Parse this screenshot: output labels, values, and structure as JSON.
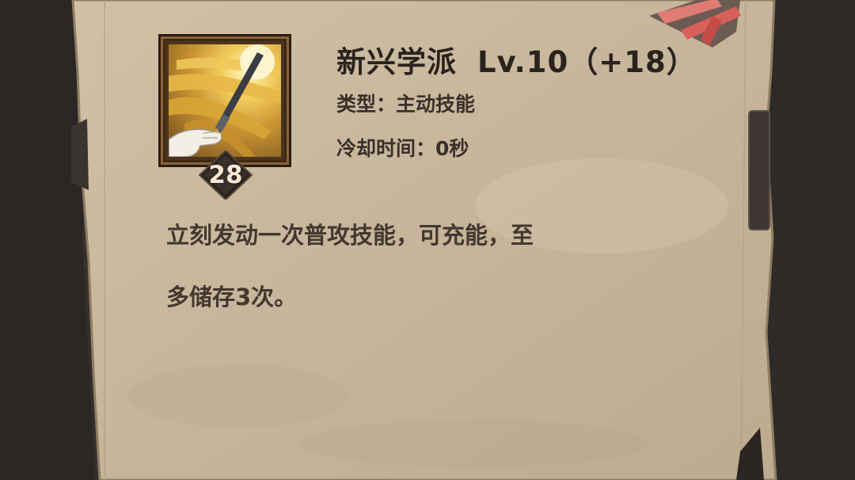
{
  "skill": {
    "name": "新兴学派",
    "level_text": "Lv.10（+18）",
    "type_label": "类型：",
    "type_value": "主动技能",
    "cooldown_label": "冷却时间：",
    "cooldown_value": "0秒",
    "badge_number": "28",
    "icon": "feather-quill-icon",
    "description_lines": [
      "立刻发动一次普攻技能，可充能，至",
      "多储存3次。"
    ]
  },
  "colors": {
    "parchment": "#c9b9a0",
    "parchment_dark": "#a8957a",
    "text_title": "#2a221c",
    "text_body": "#43382f",
    "frame": "#4a3420",
    "accent_red": "#d9605a"
  }
}
